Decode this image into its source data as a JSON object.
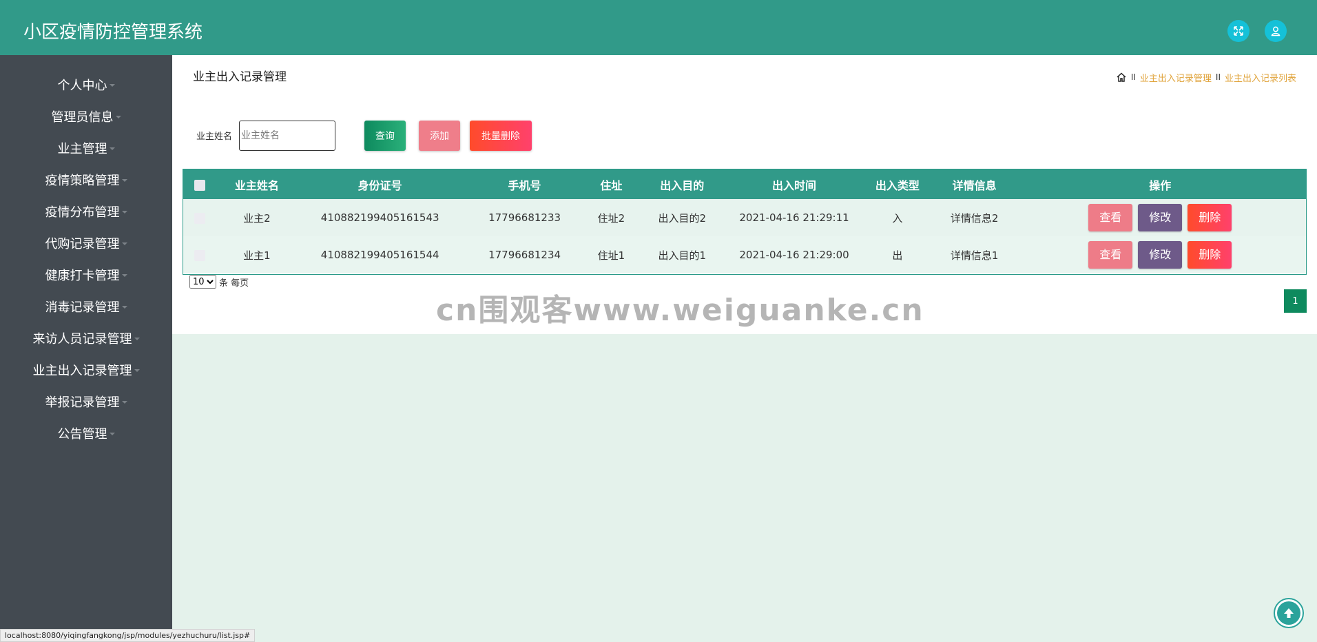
{
  "header": {
    "title": "小区疫情防控管理系统",
    "fullscreen_icon": "expand-icon",
    "user_icon": "user-icon"
  },
  "sidebar": {
    "items": [
      {
        "label": "个人中心"
      },
      {
        "label": "管理员信息"
      },
      {
        "label": "业主管理"
      },
      {
        "label": "疫情策略管理"
      },
      {
        "label": "疫情分布管理"
      },
      {
        "label": "代购记录管理"
      },
      {
        "label": "健康打卡管理"
      },
      {
        "label": "消毒记录管理"
      },
      {
        "label": "来访人员记录管理"
      },
      {
        "label": "业主出入记录管理"
      },
      {
        "label": "举报记录管理"
      },
      {
        "label": "公告管理"
      }
    ]
  },
  "main": {
    "title": "业主出入记录管理",
    "breadcrumb": {
      "sep": "II",
      "level1": "业主出入记录管理",
      "level2": "业主出入记录列表"
    },
    "search": {
      "label": "业主姓名",
      "placeholder": "业主姓名",
      "value": ""
    },
    "buttons": {
      "query": "查询",
      "add": "添加",
      "batch_delete": "批量删除"
    },
    "table": {
      "columns": [
        "业主姓名",
        "身份证号",
        "手机号",
        "住址",
        "出入目的",
        "出入时间",
        "出入类型",
        "详情信息",
        "操作"
      ],
      "rows": [
        {
          "name": "业主2",
          "id_number": "410882199405161543",
          "phone": "17796681233",
          "address": "住址2",
          "purpose": "出入目的2",
          "time": "2021-04-16 21:29:11",
          "type": "入",
          "detail": "详情信息2"
        },
        {
          "name": "业主1",
          "id_number": "410882199405161544",
          "phone": "17796681234",
          "address": "住址1",
          "purpose": "出入目的1",
          "time": "2021-04-16 21:29:00",
          "type": "出",
          "detail": "详情信息1"
        }
      ],
      "actions": {
        "view": "查看",
        "edit": "修改",
        "delete": "删除"
      }
    },
    "pagination": {
      "page_size": "10",
      "page_size_suffix": "条 每页",
      "current_page": "1"
    }
  },
  "watermark": "cn围观客www.weiguanke.cn",
  "status_url": "localhost:8080/yiqingfangkong/jsp/modules/yezhuchuru/list.jsp#",
  "colors": {
    "header": "#319a89",
    "sidebar": "#434a51",
    "breadcrumb_link": "#e0a33a",
    "body_bg": "#e4f2eb"
  }
}
